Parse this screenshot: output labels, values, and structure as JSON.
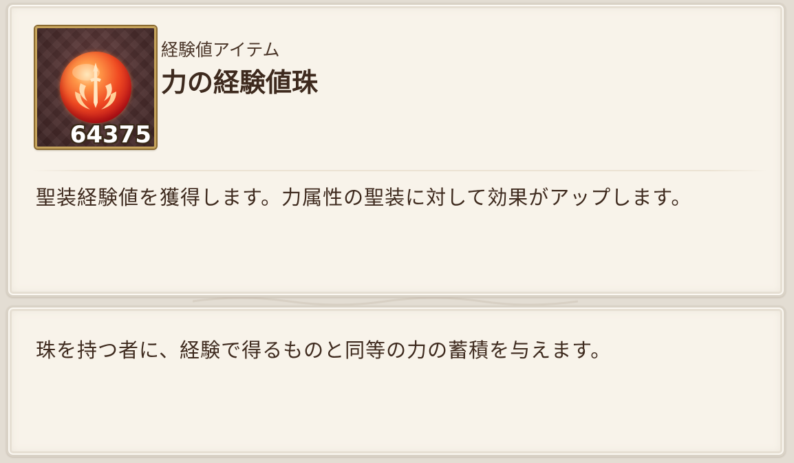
{
  "item": {
    "category": "経験値アイテム",
    "name": "力の経験値珠",
    "count": "64375",
    "icon": "power-exp-orb-icon",
    "description": "聖装経験値を獲得します。力属性の聖装に対して効果がアップします。",
    "flavor_text": "珠を持つ者に、経験で得るものと同等の力の蓄積を与えます。"
  },
  "colors": {
    "panel_bg": "#f8f3ea",
    "text": "#3e2a1e",
    "icon_frame": "#c6a45c",
    "orb_red": "#f04a22"
  }
}
